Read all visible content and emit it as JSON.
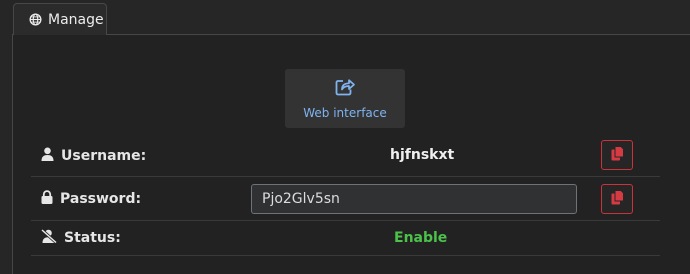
{
  "tab": {
    "label": "Manage",
    "icon": "globe-icon"
  },
  "web_button": {
    "label": "Web interface",
    "icon": "share-external-icon"
  },
  "rows": {
    "username": {
      "label": "Username:",
      "value": "hjfnskxt",
      "icon": "user-icon"
    },
    "password": {
      "label": "Password:",
      "value": "Pjo2Glv5sn",
      "icon": "lock-icon"
    },
    "status": {
      "label": "Status:",
      "value": "Enable",
      "icon": "user-slash-icon"
    }
  },
  "colors": {
    "accent": "#7fb4f0",
    "danger": "#d63a42",
    "success": "#4cc24a",
    "background": "#262626"
  }
}
